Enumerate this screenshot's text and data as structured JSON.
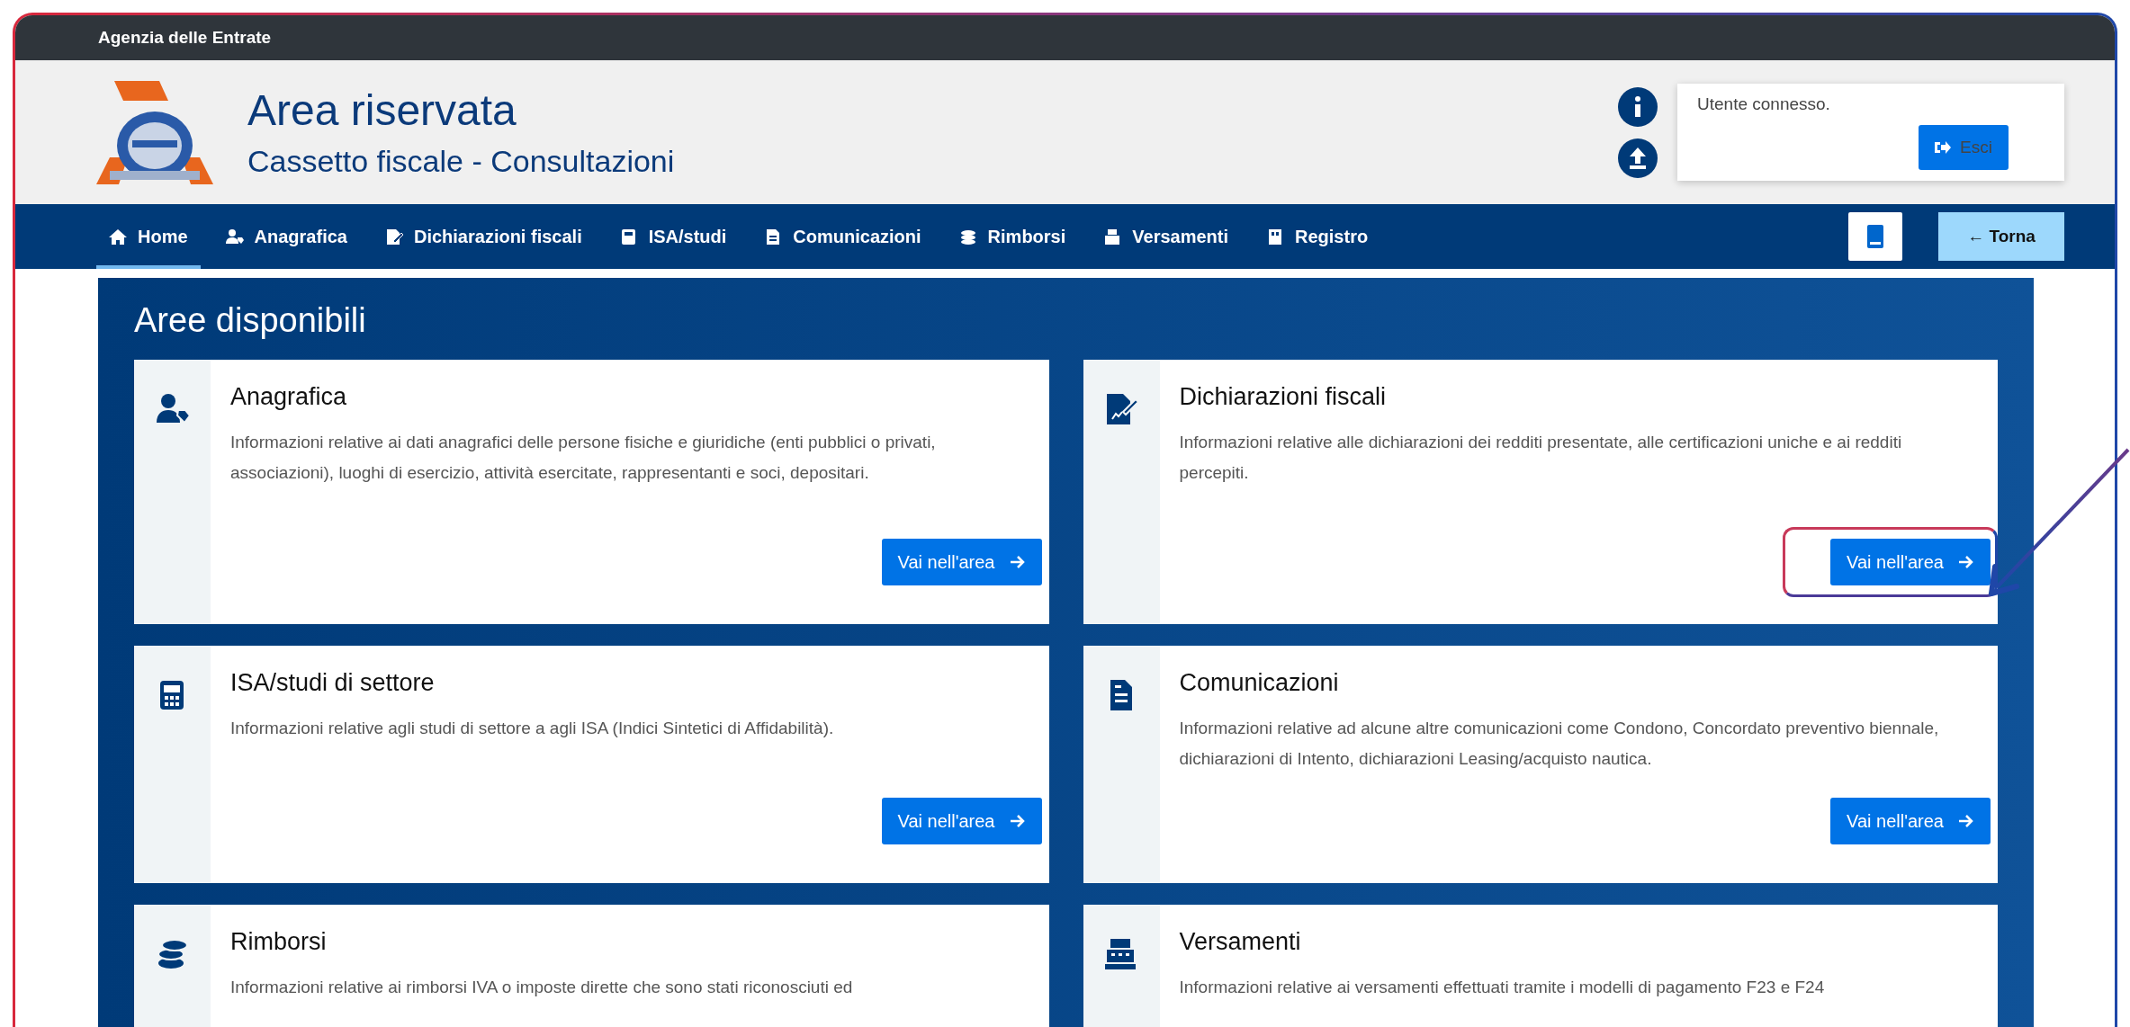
{
  "top_bar": {
    "title": "Agenzia delle Entrate"
  },
  "header": {
    "title": "Area riservata",
    "subtitle": "Cassetto fiscale - Consultazioni",
    "user_box": {
      "label": "Utente connesso.",
      "logout_button": "Esci"
    }
  },
  "nav": {
    "items": [
      {
        "label": "Home",
        "selected": true
      },
      {
        "label": "Anagrafica",
        "selected": false
      },
      {
        "label": "Dichiarazioni fiscali",
        "selected": false
      },
      {
        "label": "ISA/studi",
        "selected": false
      },
      {
        "label": "Comunicazioni",
        "selected": false
      },
      {
        "label": "Rimborsi",
        "selected": false
      },
      {
        "label": "Versamenti",
        "selected": false
      },
      {
        "label": "Registro",
        "selected": false
      }
    ],
    "back_button": "← Torna"
  },
  "main": {
    "title": "Aree disponibili",
    "cards": [
      {
        "title": "Anagrafica",
        "description": "Informazioni relative ai dati anagrafici delle persone fisiche e giuridiche (enti pubblici o privati, associazioni), luoghi di esercizio, attività esercitate, rappresentanti e soci, depositari.",
        "button": "Vai nell'area",
        "highlighted": false
      },
      {
        "title": "Dichiarazioni fiscali",
        "description": "Informazioni relative alle dichiarazioni dei redditi presentate, alle certificazioni uniche e ai redditi percepiti.",
        "button": "Vai nell'area",
        "highlighted": true
      },
      {
        "title": "ISA/studi di settore",
        "description": "Informazioni relative agli studi di settore a agli ISA (Indici Sintetici di Affidabilità).",
        "button": "Vai nell'area",
        "highlighted": false
      },
      {
        "title": "Comunicazioni",
        "description": "Informazioni relative ad alcune altre comunicazioni come Condono, Concordato preventivo biennale, dichiarazioni di Intento, dichiarazioni Leasing/acquisto nautica.",
        "button": "Vai nell'area",
        "highlighted": false
      },
      {
        "title": "Rimborsi",
        "description": "Informazioni relative ai rimborsi IVA o imposte dirette che sono stati riconosciuti ed"
      },
      {
        "title": "Versamenti",
        "description": "Informazioni relative ai versamenti effettuati tramite i modelli di pagamento F23 e F24"
      }
    ]
  }
}
